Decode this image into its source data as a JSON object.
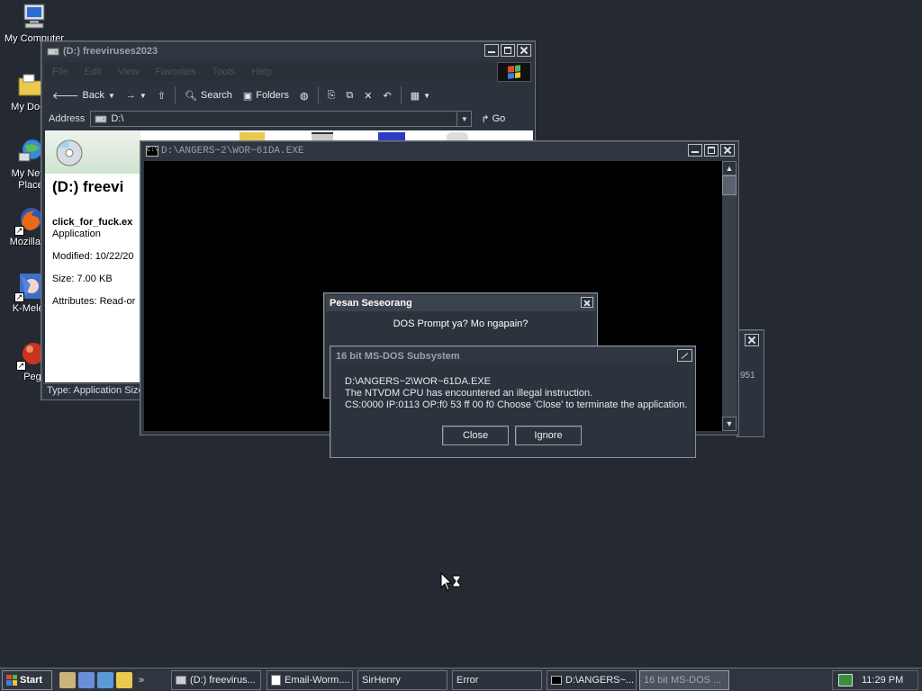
{
  "desktop": {
    "icons": [
      {
        "label": "My Computer"
      },
      {
        "label": "My Docu"
      },
      {
        "label": "My Netw",
        "label2": "Place"
      },
      {
        "label": "Mozilla Fi"
      },
      {
        "label": "K-Melec"
      },
      {
        "label": "Peg"
      }
    ]
  },
  "explorer": {
    "title": "(D:) freeviruses2023",
    "menu": [
      "File",
      "Edit",
      "View",
      "Favorites",
      "Tools",
      "Help"
    ],
    "toolbar": {
      "back": "Back",
      "search": "Search",
      "folders": "Folders"
    },
    "address": {
      "label": "Address",
      "value": "D:\\",
      "go": "Go"
    },
    "webview": {
      "title": "(D:) freevi",
      "file_name": "click_for_fuck.ex",
      "file_type": "Application",
      "modified": "Modified: 10/22/20",
      "size": "Size: 7.00 KB",
      "attributes": "Attributes: Read-or"
    },
    "status": "Type: Application Size"
  },
  "dos_window": {
    "title": "D:\\ANGERS~2\\WOR~61DA.EXE"
  },
  "email_window": {
    "fragment": "951"
  },
  "message_box": {
    "title": "Pesan Seseorang",
    "text": "DOS Prompt ya? Mo ngapain?"
  },
  "ntvdm_dialog": {
    "title": "16 bit MS-DOS Subsystem",
    "lines": [
      "D:\\ANGERS~2\\WOR~61DA.EXE",
      "The NTVDM CPU has encountered an illegal instruction.",
      "CS:0000 IP:0113 OP:f0 53 ff 00 f0 Choose 'Close' to terminate the application."
    ],
    "close_label": "Close",
    "ignore_label": "Ignore"
  },
  "taskbar": {
    "start_label": "Start",
    "tasks": [
      {
        "label": "(D:) freevirus...",
        "icon": "drive-icon"
      },
      {
        "label": "Email-Worm....",
        "icon": "notepad-icon"
      },
      {
        "label": "SirHenry",
        "icon": "none"
      },
      {
        "label": "Error",
        "icon": "none"
      },
      {
        "label": "D:\\ANGERS~...",
        "icon": "console-icon"
      },
      {
        "label": "16 bit MS-DOS ...",
        "icon": "none"
      }
    ],
    "clock": "11:29 PM"
  },
  "colors": {
    "desktop": "#252a32",
    "window_face": "#2c333c",
    "console": "#000000"
  }
}
